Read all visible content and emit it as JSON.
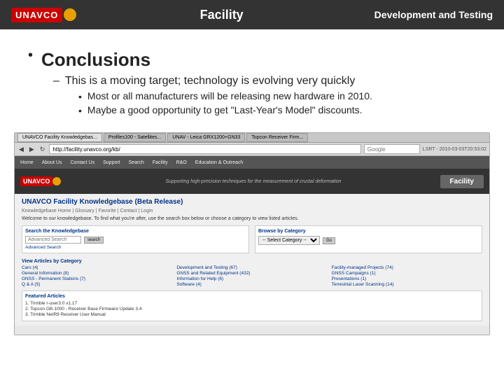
{
  "header": {
    "logo_text": "UNAVCO",
    "title": "Facility",
    "right_text": "Development and Testing"
  },
  "main": {
    "bullet_symbol": "•",
    "conclusions_label": "Conclusions",
    "dash_symbol": "–",
    "dash_text": "This is a moving target; technology is evolving very quickly",
    "sub_bullets": [
      "Most or all manufacturers will be releasing new hardware in 2010.",
      "Maybe a good opportunity to get \"Last-Year's Model\" discounts."
    ]
  },
  "browser": {
    "tab1": "UNAVCO Facility Knowledgebas...",
    "tab2": "Profiles100 - Satellites...",
    "tab3": "UNAV - Leica GRX1200+GN33",
    "tab4": "Topcon Receiver Firm...",
    "url": "http://facility.unavco.org/kb/",
    "search_placeholder": "Google",
    "lsrt_label": "LSRT - 2010-03-03T20:53:02",
    "nav_items": [
      "Home",
      "About Us",
      "Contact Us",
      "Support",
      "Search",
      "Facility",
      "R&O",
      "Education & Outreach"
    ]
  },
  "site": {
    "logo_text": "UNAVCO",
    "tagline": "Supporting high-precision techniques for the measurement of crustal deformation",
    "facility_badge": "Facility",
    "title": "UNAVCO Facility Knowledgebase (Beta Release)",
    "breadcrumb": "Knowledgebase Home | Glossary | Favorite | Contact | Login",
    "welcome_text": "Welcome to our knowledgebase. To find what you're after, use the search box below or choose a category to view listed articles.",
    "search_section_title": "Search the Knowledgebase",
    "search_placeholder": "Advanced Search",
    "browse_title": "Browse by Category",
    "browse_placeholder": "-- Select Category --",
    "view_articles_title": "View Articles by Category",
    "categories_col1": [
      "Cars (4)",
      "General Information (8)",
      "GNSS - Permanent Stations (7)",
      "Q & A (5)"
    ],
    "categories_col2": [
      "Development and Testing (67)",
      "GNSS and Related Equipment (432)",
      "Information for Help (6)",
      "Software (4)"
    ],
    "categories_col3": [
      "Facility-managed Projects (74)",
      "GNSS Campaigns (1)",
      "Presentations (1)",
      "Terrestrial Laser Scanning (14)"
    ],
    "featured_title": "Featured Articles",
    "featured_items": [
      "1. Trimble r-user3.0 v1.17",
      "2. Topcon GB-1000 - Receiver Base Firmware Update 3.4",
      "3. Trimble NetR9 Receiver User Manual"
    ]
  }
}
